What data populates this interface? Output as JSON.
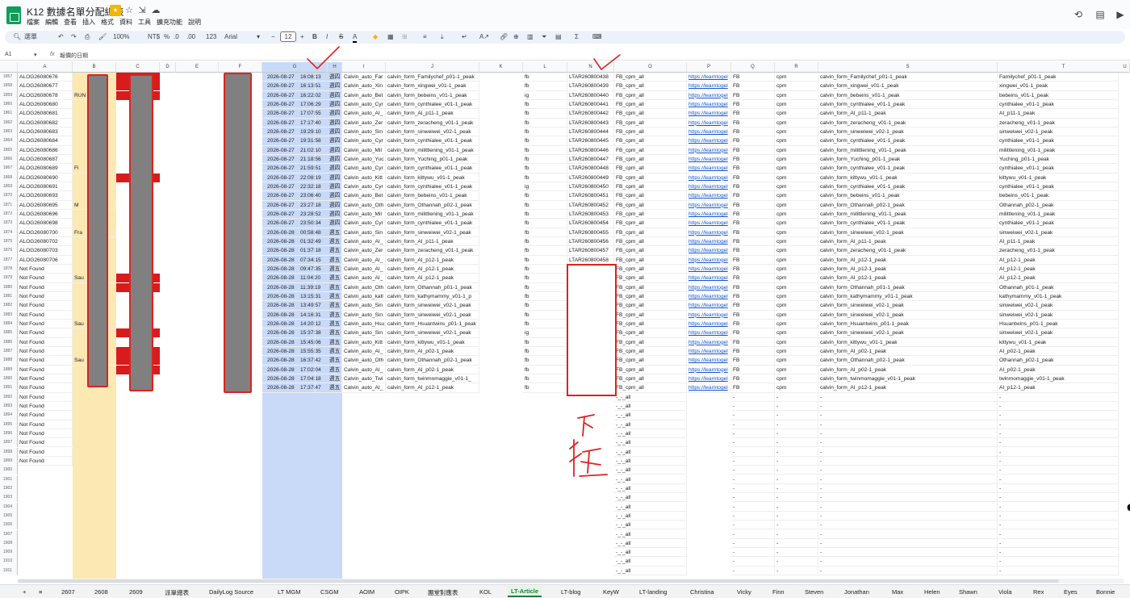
{
  "title_bar": {
    "doc_title": "K12 數據名單分配總表",
    "icons": [
      "folder-star-icon",
      "star-icon",
      "move-icon",
      "cloud-status-icon"
    ]
  },
  "menu": [
    "檔案",
    "編輯",
    "查看",
    "插入",
    "格式",
    "資料",
    "工具",
    "擴充功能",
    "說明"
  ],
  "right_icons": [
    "history-icon",
    "comment-icon",
    "video-meet-icon"
  ],
  "toolbar": {
    "search": "選單",
    "zoom": "100%",
    "currency": "NT$",
    "percent": "%",
    "decimals_less": ".0",
    "decimals_more": ".00",
    "number_format": "123",
    "font": "Arial",
    "font_size": "12",
    "minus": "−",
    "plus": "+",
    "bold": "B",
    "italic": "I",
    "strike": "S",
    "text_color": "A"
  },
  "formula_bar": {
    "name_box": "A1",
    "fx": "fx",
    "value": "報價的日期"
  },
  "columns": [
    "A",
    "B",
    "C",
    "D",
    "E",
    "F",
    "G",
    "H",
    "I",
    "J",
    "K",
    "L",
    "M",
    "N",
    "O",
    "P",
    "Q",
    "R",
    "S",
    "T",
    "U"
  ],
  "rows": [
    {
      "num": "1857",
      "a": "ALOG26080676",
      "g": "2026-08-27",
      "t": "16:08:13",
      "h": "週四",
      "i": "Calvin_auto_Far",
      "j": "calvin_form_Familychef_p01-1_peak",
      "l": "fb",
      "n": "LTAR260800438",
      "o": "FB_cpm_all",
      "p": "https://learntogel",
      "q": "FB",
      "r": "cpm",
      "s": "calvin_form_Familychef_p01-1_peak",
      "u": "Familychef_p01-1_peak"
    },
    {
      "num": "1858",
      "a": "ALOG26080677",
      "g": "2026-08-27",
      "t": "16:13:51",
      "h": "週四",
      "i": "Calvin_auto_Xin",
      "j": "calvin_form_xingwei_v01-1_peak",
      "l": "fb",
      "n": "LTAR260800439",
      "o": "FB_cpm_all",
      "p": "https://learntogel",
      "q": "FB",
      "r": "cpm",
      "s": "calvin_form_xingwei_v01-1_peak",
      "u": "xingwei_v01-1_peak"
    },
    {
      "num": "1859",
      "a": "ALOG26080678",
      "b": "RUN",
      "g": "2026-08-27",
      "t": "16:22:02",
      "h": "週四",
      "i": "Calvin_auto_Bet",
      "j": "calvin_form_bebeins_v01-1_peak",
      "l": "ig",
      "n": "LTAR260800440",
      "o": "FB_cpm_all",
      "p": "https://learntogel",
      "q": "FB",
      "r": "cpm",
      "s": "calvin_form_bebeins_v01-1_peak",
      "u": "bebeins_v01-1_peak"
    },
    {
      "num": "1860",
      "a": "ALOG26080680",
      "g": "2026-08-27",
      "t": "17:06:29",
      "h": "週四",
      "i": "Calvin_auto_Cyr",
      "j": "calvin_form_cynthialee_v01-1_peak",
      "l": "fb",
      "n": "LTAR260800441",
      "o": "FB_cpm_all",
      "p": "https://learntogel",
      "q": "FB",
      "r": "cpm",
      "s": "calvin_form_cynthialee_v01-1_peak",
      "u": "cynthialee_v01-1_peak"
    },
    {
      "num": "1861",
      "a": "ALOG26080681",
      "g": "2026-08-27",
      "t": "17:07:55",
      "h": "週四",
      "i": "Calvin_auto_AI_",
      "j": "calvin_form_AI_p11-1_peak",
      "l": "fb",
      "n": "LTAR260800442",
      "o": "FB_cpm_all",
      "p": "https://learntogel",
      "q": "FB",
      "r": "cpm",
      "s": "calvin_form_AI_p11-1_peak",
      "u": "AI_p11-1_peak"
    },
    {
      "num": "1862",
      "a": "ALOG26080682",
      "g": "2026-08-27",
      "t": "17:17:40",
      "h": "週四",
      "i": "Calvin_auto_Zer",
      "j": "calvin_form_zeracheng_v01-1_peak",
      "l": "fb",
      "n": "LTAR260800443",
      "o": "FB_cpm_all",
      "p": "https://learntogel",
      "q": "FB",
      "r": "cpm",
      "s": "calvin_form_zeracheng_v01-1_peak",
      "u": "zeracheng_v01-1_peak"
    },
    {
      "num": "1863",
      "a": "ALOG26080683",
      "g": "2026-08-27",
      "t": "19:29:10",
      "h": "週四",
      "i": "Calvin_auto_Sin",
      "j": "calvin_form_sinweiwei_v02-1_peak",
      "l": "fb",
      "n": "LTAR260800444",
      "o": "FB_cpm_all",
      "p": "https://learntogel",
      "q": "FB",
      "r": "cpm",
      "s": "calvin_form_sinweiwei_v02-1_peak",
      "u": "sinweiwei_v02-1_peak"
    },
    {
      "num": "1864",
      "a": "ALOG26080684",
      "g": "2026-08-27",
      "t": "19:31:58",
      "h": "週四",
      "i": "Calvin_auto_Cyr",
      "j": "calvin_form_cynthialee_v01-1_peak",
      "l": "fb",
      "n": "LTAR260800445",
      "o": "FB_cpm_all",
      "p": "https://learntogel",
      "q": "FB",
      "r": "cpm",
      "s": "calvin_form_cynthialee_v01-1_peak",
      "u": "cynthialee_v01-1_peak"
    },
    {
      "num": "1865",
      "a": "ALOG26080686",
      "g": "2026-08-27",
      "t": "21:02:10",
      "h": "週四",
      "i": "Calvin_auto_Mil",
      "j": "calvin_form_milittlening_v01-1_peak",
      "l": "fb",
      "n": "LTAR260800446",
      "o": "FB_cpm_all",
      "p": "https://learntogel",
      "q": "FB",
      "r": "cpm",
      "s": "calvin_form_milittlening_v01-1_peak",
      "u": "milittlening_v01-1_peak"
    },
    {
      "num": "1866",
      "a": "ALOG26080687",
      "g": "2026-08-27",
      "t": "21:18:56",
      "h": "週四",
      "i": "Calvin_auto_Yuc",
      "j": "calvin_form_Yuching_p01-1_peak",
      "l": "fb",
      "n": "LTAR260800447",
      "o": "FB_cpm_all",
      "p": "https://learntogel",
      "q": "FB",
      "r": "cpm",
      "s": "calvin_form_Yuching_p01-1_peak",
      "u": "Yuching_p01-1_peak"
    },
    {
      "num": "1867",
      "a": "ALOG26080689",
      "b": "Fi",
      "g": "2026-08-27",
      "t": "21:59:51",
      "h": "週四",
      "i": "Calvin_auto_Cyr",
      "j": "calvin_form_cynthialee_v01-1_peak",
      "l": "fb",
      "n": "LTAR260800448",
      "o": "FB_cpm_all",
      "p": "https://learntogel",
      "q": "FB",
      "r": "cpm",
      "s": "calvin_form_cynthialee_v01-1_peak",
      "u": "cynthialee_v01-1_peak"
    },
    {
      "num": "1868",
      "a": "ALOG26080690",
      "g": "2026-08-27",
      "t": "22:08:19",
      "h": "週四",
      "i": "Calvin_auto_Kitt",
      "j": "calvin_form_kittywu_v01-1_peak",
      "l": "fb",
      "n": "LTAR260800449",
      "o": "FB_cpm_all",
      "p": "https://learntogel",
      "q": "FB",
      "r": "cpm",
      "s": "calvin_form_kittywu_v01-1_peak",
      "u": "kittywu_v01-1_peak"
    },
    {
      "num": "1869",
      "a": "ALOG26080691",
      "g": "2026-08-27",
      "t": "22:32:18",
      "h": "週四",
      "i": "Calvin_auto_Cyr",
      "j": "calvin_form_cynthialee_v01-1_peak",
      "l": "ig",
      "n": "LTAR260800450",
      "o": "FB_cpm_all",
      "p": "https://learntogel",
      "q": "FB",
      "r": "cpm",
      "s": "calvin_form_cynthialee_v01-1_peak",
      "u": "cynthialee_v01-1_peak"
    },
    {
      "num": "1870",
      "a": "ALOG26080693",
      "g": "2026-08-27",
      "t": "23:06:40",
      "h": "週四",
      "i": "Calvin_auto_Bet",
      "j": "calvin_form_bebeins_v01-1_peak",
      "l": "fb",
      "n": "LTAR260800451",
      "o": "FB_cpm_all",
      "p": "https://learntogel",
      "q": "FB",
      "r": "cpm",
      "s": "calvin_form_bebeins_v01-1_peak",
      "u": "bebeins_v01-1_peak"
    },
    {
      "num": "1871",
      "a": "ALOG26080695",
      "b": "M",
      "g": "2026-08-27",
      "t": "23:27:18",
      "h": "週四",
      "i": "Calvin_auto_Oth",
      "j": "calvin_form_Othannah_p02-1_peak",
      "l": "fb",
      "n": "LTAR260800452",
      "o": "FB_cpm_all",
      "p": "https://learntogel",
      "q": "FB",
      "r": "cpm",
      "s": "calvin_form_Othannah_p02-1_peak",
      "u": "Othannah_p02-1_peak"
    },
    {
      "num": "1872",
      "a": "ALOG26080696",
      "g": "2026-08-27",
      "t": "23:28:52",
      "h": "週四",
      "i": "Calvin_auto_Mil",
      "j": "calvin_form_milittlening_v01-1_peak",
      "l": "fb",
      "n": "LTAR260800453",
      "o": "FB_cpm_all",
      "p": "https://learntogel",
      "q": "FB",
      "r": "cpm",
      "s": "calvin_form_milittlening_v01-1_peak",
      "u": "milittlening_v01-1_peak"
    },
    {
      "num": "1873",
      "a": "ALOG26080698",
      "g": "2026-08-27",
      "t": "23:50:34",
      "h": "週四",
      "i": "Calvin_auto_Cyr",
      "j": "calvin_form_cynthialee_v01-1_peak",
      "l": "fb",
      "n": "LTAR260800454",
      "o": "FB_cpm_all",
      "p": "https://learntogel",
      "q": "FB",
      "r": "cpm",
      "s": "calvin_form_cynthialee_v01-1_peak",
      "u": "cynthialee_v01-1_peak"
    },
    {
      "num": "1874",
      "a": "ALOG26080700",
      "b": "Fra",
      "g": "2026-08-28",
      "t": "00:58:48",
      "h": "週五",
      "i": "Calvin_auto_Sin",
      "j": "calvin_form_sinweiwei_v02-1_peak",
      "l": "fb",
      "n": "LTAR260800455",
      "o": "FB_cpm_all",
      "p": "https://learntogel",
      "q": "FB",
      "r": "cpm",
      "s": "calvin_form_sinweiwei_v02-1_peak",
      "u": "sinweiwei_v02-1_peak"
    },
    {
      "num": "1875",
      "a": "ALOG26080702",
      "g": "2026-08-28",
      "t": "01:32:49",
      "h": "週五",
      "i": "Calvin_auto_AI_",
      "j": "calvin_form_AI_p11-1_peak",
      "l": "fb",
      "n": "LTAR260800456",
      "o": "FB_cpm_all",
      "p": "https://learntogel",
      "q": "FB",
      "r": "cpm",
      "s": "calvin_form_AI_p11-1_peak",
      "u": "AI_p11-1_peak"
    },
    {
      "num": "1876",
      "a": "ALOG26080703",
      "g": "2026-08-28",
      "t": "01:37:18",
      "h": "週五",
      "i": "Calvin_auto_Zer",
      "j": "calvin_form_zeracheng_v01-1_peak",
      "l": "fb",
      "n": "LTAR260800457",
      "o": "FB_cpm_all",
      "p": "https://learntogel",
      "q": "FB",
      "r": "cpm",
      "s": "calvin_form_zeracheng_v01-1_peak",
      "u": "zeracheng_v01-1_peak"
    },
    {
      "num": "1877",
      "a": "ALOG26080706",
      "g": "2026-08-28",
      "t": "07:34:15",
      "h": "週五",
      "i": "Calvin_auto_AI_",
      "j": "calvin_form_AI_p12-1_peak",
      "l": "fb",
      "n": "LTAR260800458",
      "o": "FB_cpm_all",
      "p": "https://learntogel",
      "q": "FB",
      "r": "cpm",
      "s": "calvin_form_AI_p12-1_peak",
      "u": "AI_p12-1_peak"
    },
    {
      "num": "1878",
      "a": "Not Found",
      "g": "2026-08-28",
      "t": "09:47:35",
      "h": "週五",
      "i": "Calvin_auto_AI_",
      "j": "calvin_form_AI_p12-1_peak",
      "l": "fb",
      "o": "FB_cpm_all",
      "p": "https://learntogel",
      "q": "FB",
      "r": "cpm",
      "s": "calvin_form_AI_p12-1_peak",
      "u": "AI_p12-1_peak"
    },
    {
      "num": "1879",
      "a": "Not Found",
      "b": "Sau",
      "g": "2026-08-28",
      "t": "11:04:20",
      "h": "週五",
      "i": "Calvin_auto_AI_",
      "j": "calvin_form_AI_p12-1_peak",
      "l": "fb",
      "o": "FB_cpm_all",
      "p": "https://learntogel",
      "q": "FB",
      "r": "cpm",
      "s": "calvin_form_AI_p12-1_peak",
      "u": "AI_p12-1_peak"
    },
    {
      "num": "1880",
      "a": "Not Found",
      "g": "2026-08-28",
      "t": "11:39:19",
      "h": "週五",
      "i": "Calvin_auto_Oth",
      "j": "calvin_form_Othannah_p01-1_peak",
      "l": "fb",
      "o": "FB_cpm_all",
      "p": "https://learntogel",
      "q": "FB",
      "r": "cpm",
      "s": "calvin_form_Othannah_p01-1_peak",
      "u": "Othannah_p01-1_peak"
    },
    {
      "num": "1881",
      "a": "Not Found",
      "g": "2026-08-28",
      "t": "13:15:31",
      "h": "週五",
      "i": "Calvin_auto_katl",
      "j": "calvin_form_kathymammy_v01-1_p",
      "l": "fb",
      "o": "FB_cpm_all",
      "p": "https://learntogel",
      "q": "FB",
      "r": "cpm",
      "s": "calvin_form_kathymammy_v01-1_peak",
      "u": "kathymammy_v01-1_peak"
    },
    {
      "num": "1882",
      "a": "Not Found",
      "g": "2026-08-28",
      "t": "13:49:57",
      "h": "週五",
      "i": "Calvin_auto_Sin",
      "j": "calvin_form_sinweiwei_v02-1_peak",
      "l": "fb",
      "o": "FB_cpm_all",
      "p": "https://learntogel",
      "q": "FB",
      "r": "cpm",
      "s": "calvin_form_sinweiwei_v02-1_peak",
      "u": "sinweiwei_v02-1_peak"
    },
    {
      "num": "1883",
      "a": "Not Found",
      "g": "2026-08-28",
      "t": "14:16:31",
      "h": "週五",
      "i": "Calvin_auto_Sin",
      "j": "calvin_form_sinweiwei_v02-1_peak",
      "l": "fb",
      "o": "FB_cpm_all",
      "p": "https://learntogel",
      "q": "FB",
      "r": "cpm",
      "s": "calvin_form_sinweiwei_v02-1_peak",
      "u": "sinweiwei_v02-1_peak"
    },
    {
      "num": "1884",
      "a": "Not Found",
      "b": "Sau",
      "g": "2026-08-28",
      "t": "14:20:12",
      "h": "週五",
      "i": "Calvin_auto_Hsu",
      "j": "calvin_form_Hsuantwins_p01-1_peak",
      "l": "fb",
      "o": "FB_cpm_all",
      "p": "https://learntogel",
      "q": "FB",
      "r": "cpm",
      "s": "calvin_form_Hsuantwins_p01-1_peak",
      "u": "Hsuantwins_p01-1_peak"
    },
    {
      "num": "1885",
      "a": "Not Found",
      "g": "2026-08-28",
      "t": "15:37:38",
      "h": "週五",
      "i": "Calvin_auto_Sin",
      "j": "calvin_form_sinweiwei_v02-1_peak",
      "l": "ig",
      "o": "FB_cpm_all",
      "p": "https://learntogel",
      "q": "FB",
      "r": "cpm",
      "s": "calvin_form_sinweiwei_v02-1_peak",
      "u": "sinweiwei_v02-1_peak"
    },
    {
      "num": "1886",
      "a": "Not Found",
      "g": "2026-08-28",
      "t": "15:45:06",
      "h": "週五",
      "i": "Calvin_auto_Kitt",
      "j": "calvin_form_kittywu_v01-1_peak",
      "l": "fb",
      "o": "FB_cpm_all",
      "p": "https://learntogel",
      "q": "FB",
      "r": "cpm",
      "s": "calvin_form_kittywu_v01-1_peak",
      "u": "kittywu_v01-1_peak"
    },
    {
      "num": "1887",
      "a": "Not Found",
      "g": "2026-08-28",
      "t": "15:55:35",
      "h": "週五",
      "i": "Calvin_auto_AI_",
      "j": "calvin_form_AI_p02-1_peak",
      "l": "fb",
      "o": "FB_cpm_all",
      "p": "https://learntogel",
      "q": "FB",
      "r": "cpm",
      "s": "calvin_form_AI_p02-1_peak",
      "u": "AI_p02-1_peak"
    },
    {
      "num": "1888",
      "a": "Not Found",
      "b": "Sau",
      "g": "2026-08-28",
      "t": "16:37:42",
      "h": "週五",
      "i": "Calvin_auto_Oth",
      "j": "calvin_form_Othannah_p02-1_peak",
      "l": "fb",
      "o": "FB_cpm_all",
      "p": "https://learntogel",
      "q": "FB",
      "r": "cpm",
      "s": "calvin_form_Othannah_p02-1_peak",
      "u": "Othannah_p02-1_peak"
    },
    {
      "num": "1889",
      "a": "Not Found",
      "g": "2026-08-28",
      "t": "17:02:04",
      "h": "週五",
      "i": "Calvin_auto_AI_",
      "j": "calvin_form_AI_p02-1_peak",
      "l": "fb",
      "o": "FB_cpm_all",
      "p": "https://learntogel",
      "q": "FB",
      "r": "cpm",
      "s": "calvin_form_AI_p02-1_peak",
      "u": "AI_p02-1_peak"
    },
    {
      "num": "1890",
      "a": "Not Found",
      "g": "2026-08-28",
      "t": "17:04:18",
      "h": "週五",
      "i": "Calvin_auto_Twi",
      "j": "calvin_form_twinmomaggie_v01-1_",
      "l": "fb",
      "o": "FB_cpm_all",
      "p": "https://learntogel",
      "q": "FB",
      "r": "cpm",
      "s": "calvin_form_twinmomaggie_v01-1_peak",
      "u": "twinmomaggie_v01-1_peak"
    },
    {
      "num": "1891",
      "a": "Not Found",
      "g": "2026-08-28",
      "t": "17:37:47",
      "h": "週五",
      "i": "Calvin_auto_AI_",
      "j": "calvin_form_AI_p12-1_peak",
      "l": "fb",
      "o": "FB_cpm_all",
      "p": "https://learntogel",
      "q": "FB",
      "r": "cpm",
      "s": "calvin_form_AI_p12-1_peak",
      "u": "AI_p12-1_peak"
    },
    {
      "num": "1892",
      "a": "Not Found",
      "o": "-_-_all",
      "q": "-",
      "r": "-",
      "s": "-",
      "u": "-"
    },
    {
      "num": "1893",
      "a": "Not Found",
      "o": "-_-_all",
      "q": "-",
      "r": "-",
      "s": "-",
      "u": "-"
    },
    {
      "num": "1894",
      "a": "Not Found",
      "o": "-_-_all",
      "q": "-",
      "r": "-",
      "s": "-",
      "u": "-"
    },
    {
      "num": "1895",
      "a": "Not Found",
      "o": "-_-_all",
      "q": "-",
      "r": "-",
      "s": "-",
      "u": "-"
    },
    {
      "num": "1896",
      "a": "Not Found",
      "o": "-_-_all",
      "q": "-",
      "r": "-",
      "s": "-",
      "u": "-"
    },
    {
      "num": "1897",
      "a": "Not Found",
      "o": "-_-_all",
      "q": "-",
      "r": "-",
      "s": "-",
      "u": "-"
    },
    {
      "num": "1898",
      "a": "Not Found",
      "o": "-_-_all",
      "q": "-",
      "r": "-",
      "s": "-",
      "u": "-"
    },
    {
      "num": "1899",
      "a": "Not Found",
      "o": "-_-_all",
      "q": "-",
      "r": "-",
      "s": "-",
      "u": "-"
    },
    {
      "num": "1900",
      "o": "-_-_all",
      "q": "-",
      "r": "-",
      "s": "-",
      "u": "-"
    },
    {
      "num": "1901",
      "o": "-_-_all",
      "q": "-",
      "r": "-",
      "s": "-",
      "u": "-"
    },
    {
      "num": "1902",
      "o": "-_-_all",
      "q": "-",
      "r": "-",
      "s": "-",
      "u": "-"
    },
    {
      "num": "1903",
      "o": "-_-_all",
      "q": "-",
      "r": "-",
      "s": "-",
      "u": "-"
    },
    {
      "num": "1904",
      "o": "-_-_all",
      "q": "-",
      "r": "-",
      "s": "-",
      "u": "-"
    },
    {
      "num": "1905",
      "o": "-_-_all",
      "q": "-",
      "r": "-",
      "s": "-",
      "u": "-"
    },
    {
      "num": "1906",
      "o": "-_-_all",
      "q": "-",
      "r": "-",
      "s": "-",
      "u": "-"
    },
    {
      "num": "1907",
      "o": "-_-_all",
      "q": "-",
      "r": "-",
      "s": "-",
      "u": "-"
    },
    {
      "num": "1908",
      "o": "-_-_all",
      "q": "-",
      "r": "-",
      "s": "-",
      "u": "-"
    },
    {
      "num": "1909",
      "o": "-_-_all",
      "q": "-",
      "r": "-",
      "s": "-",
      "u": "-"
    },
    {
      "num": "1910",
      "o": "-_-_all",
      "q": "-",
      "r": "-",
      "s": "-",
      "u": "-"
    },
    {
      "num": "1911",
      "o": "-_-_all",
      "q": "-",
      "r": "-",
      "s": "-",
      "u": "-"
    }
  ],
  "annotation": {
    "text": "下拉",
    "color": "#e02020"
  },
  "tabs": [
    "+",
    "≡",
    "2607",
    "2608",
    "2609",
    "派單總表",
    "DailyLog Source",
    "LT MGM",
    "CSGM",
    "AOIM",
    "OIPK",
    "團堂對應表",
    "KOL",
    "LT-Article",
    "LT-blog",
    "KeyW",
    "LT-landing",
    "Christina",
    "Vicky",
    "Finn",
    "Steven",
    "Jonathan",
    "Max",
    "Helen",
    "Shawn",
    "Viola",
    "Rex",
    "Eyes",
    "Bonnie"
  ],
  "active_tab": "LT-Article",
  "colors": {
    "selected_col": "#c9daf8",
    "b_col": "#fce8b2",
    "red": "#d81b1b",
    "link": "#1155cc",
    "active_tab": "#188038"
  }
}
